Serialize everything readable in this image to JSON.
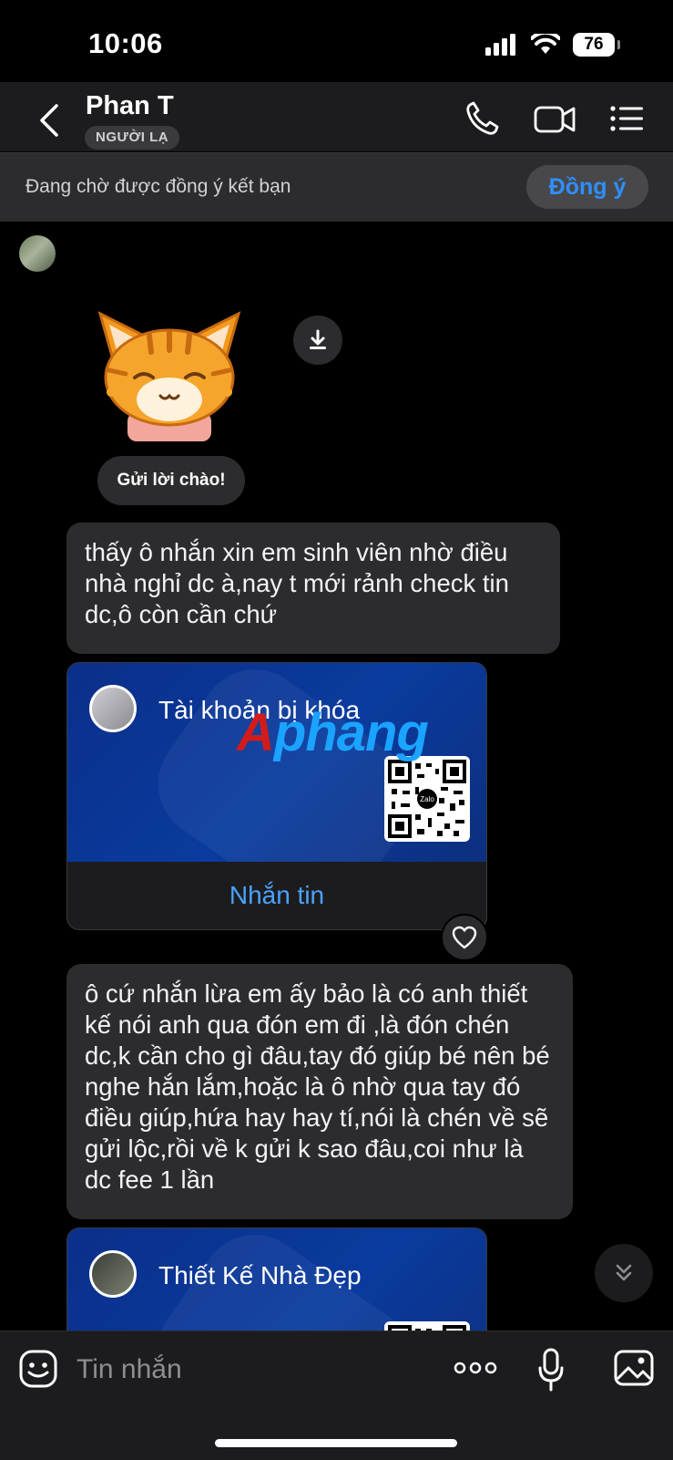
{
  "status_bar": {
    "time": "10:06",
    "battery": "76"
  },
  "header": {
    "contact_name": "Phan T",
    "badge": "NGƯỜI LẠ",
    "icons": [
      "back-arrow-icon",
      "phone-icon",
      "video-call-icon",
      "menu-list-icon"
    ]
  },
  "friend_request": {
    "text": "Đang chờ được đồng ý kết bạn",
    "accept_label": "Đồng ý"
  },
  "messages": [
    {
      "type": "sticker",
      "description_icon": "cat-sticker"
    },
    {
      "type": "quick_reply",
      "label": "Gửi lời chào!"
    },
    {
      "type": "text",
      "text": "thấy ô nhắn xin em sinh viên nhờ điều nhà nghỉ dc à,nay t mới rảnh check tin dc,ô còn cần chứ"
    },
    {
      "type": "contact_card",
      "title": "Tài khoản bị khóa",
      "action": "Nhắn tin"
    },
    {
      "type": "text",
      "text": "ô cứ nhắn lừa em ấy bảo là có anh thiết kế nói anh qua đón em đi ,là đón chén dc,k cần cho gì đâu,tay đó giúp bé nên bé nghe hắn lắm,hoặc là ô nhờ qua tay đó điều giúp,hứa hay hay tí,nói là chén về sẽ gửi lộc,rồi về k gửi k sao đâu,coi như là dc fee 1 lần"
    },
    {
      "type": "contact_card",
      "title": "Thiết Kế Nhà Đẹp"
    }
  ],
  "watermark": {
    "part1": "A",
    "part2": "phang"
  },
  "qr_label": "Zalo",
  "composer": {
    "placeholder": "Tin nhắn"
  },
  "colors": {
    "accent": "#2f8fff",
    "card_blue": "#0a3b9e",
    "bubble": "#2c2c2e"
  }
}
